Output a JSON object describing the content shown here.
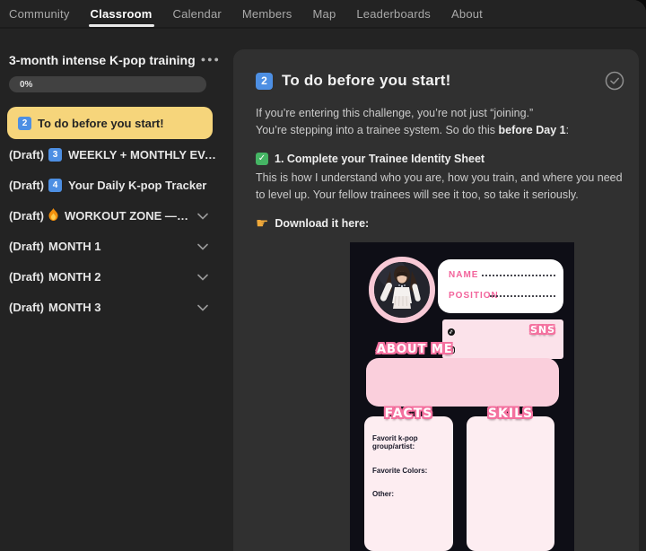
{
  "nav": {
    "items": [
      {
        "label": "Community",
        "active": false
      },
      {
        "label": "Classroom",
        "active": true
      },
      {
        "label": "Calendar",
        "active": false
      },
      {
        "label": "Members",
        "active": false
      },
      {
        "label": "Map",
        "active": false
      },
      {
        "label": "Leaderboards",
        "active": false
      },
      {
        "label": "About",
        "active": false
      }
    ]
  },
  "sidebar": {
    "course_title": "3-month intense K-pop training",
    "progress_percent": "0%",
    "items": [
      {
        "prefix": "",
        "badge": "2",
        "label": "To do before you start!",
        "selected": true,
        "expandable": false
      },
      {
        "prefix": "(Draft)",
        "badge": "3",
        "label": "WEEKLY + MONTHLY EVALUAT…",
        "selected": false,
        "expandable": false
      },
      {
        "prefix": "(Draft)",
        "badge": "4",
        "label": "Your Daily K-pop Tracker",
        "selected": false,
        "expandable": false
      },
      {
        "prefix": "(Draft)",
        "badge": "fire",
        "label": "WORKOUT ZONE — BUIL…",
        "selected": false,
        "expandable": true
      },
      {
        "prefix": "(Draft)",
        "badge": "",
        "label": "MONTH 1",
        "selected": false,
        "expandable": true
      },
      {
        "prefix": "(Draft)",
        "badge": "",
        "label": "MONTH 2",
        "selected": false,
        "expandable": true
      },
      {
        "prefix": "(Draft)",
        "badge": "",
        "label": "MONTH 3",
        "selected": false,
        "expandable": true
      }
    ]
  },
  "main": {
    "title_badge": "2",
    "title": "To do before you start!",
    "intro_line1": "If you’re entering this challenge, you’re not just “joining.”",
    "intro_line2_pre": "You’re stepping into a trainee system. So do this ",
    "intro_line2_bold": "before Day 1",
    "intro_line2_post": ":",
    "step_check": "✓",
    "step_title": "1. Complete your Trainee Identity Sheet",
    "step_body1": "This is how I understand who you are, how you train, and where you need to level up.",
    "step_body2": "Your fellow trainees will see it too, so take it seriously.",
    "pointer_glyph": "☛",
    "download_label": "Download it here:"
  },
  "card": {
    "name_label": "NAME",
    "position_label": "POSITION",
    "sns_label": "SNS",
    "about_label": "ABOUT ME",
    "facts_label": "FACTS",
    "skills_label": "SKILS",
    "facts_items": [
      "Favorit k-pop group/artist:",
      "Favorite Colors:",
      "Other:"
    ]
  },
  "colors": {
    "selected_item_bg": "#f6d57b",
    "keycap_blue": "#4d8fe3",
    "check_green": "#45b564",
    "card_bg": "#0e0e16",
    "pink_ring": "#f8c9d6",
    "pink_text": "#f2639b",
    "bubble_outline": "#f4719f",
    "panel_bg": "#303030"
  }
}
